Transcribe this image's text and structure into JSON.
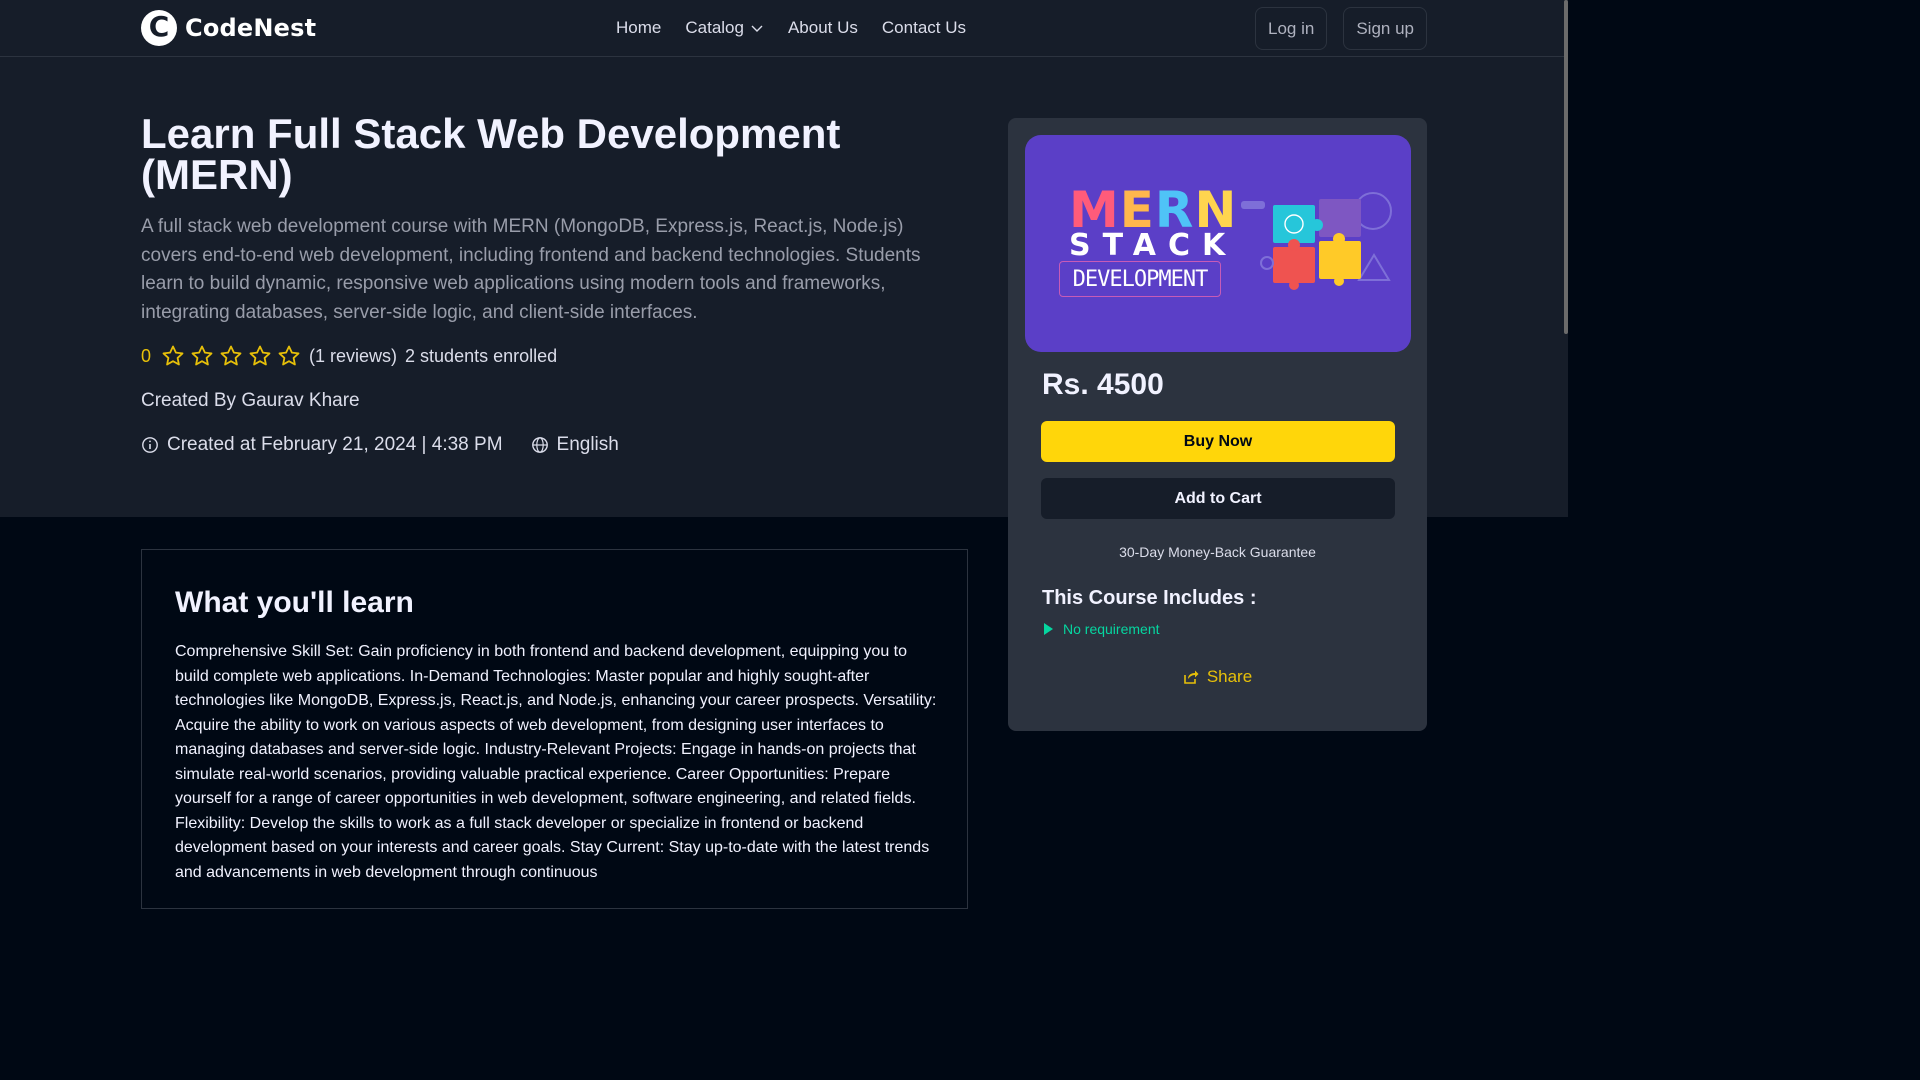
{
  "navbar": {
    "logo_mark": "C",
    "logo_text": "CodeNest",
    "links": [
      "Home",
      "Catalog",
      "About Us",
      "Contact Us"
    ],
    "login": "Log in",
    "signup": "Sign up"
  },
  "course": {
    "title": "Learn Full Stack Web Development (MERN)",
    "description": "A full stack web development course with MERN (MongoDB, Express.js, React.js, Node.js) covers end-to-end web development, including frontend and backend technologies. Students learn to build dynamic, responsive web applications using modern tools and frameworks, integrating databases, server-side logic, and client-side interfaces.",
    "rating": "0",
    "stars_filled": 0,
    "stars_total": 5,
    "reviews": "(1 reviews)",
    "enrolled": "2 students enrolled",
    "creator": "Created By Gaurav Khare",
    "created_at": "Created at February 21, 2024 | 4:38 PM",
    "language": "English"
  },
  "card": {
    "thumbnail": {
      "mern": "MERN",
      "stack": "STACK",
      "development": "DEVELOPMENT",
      "colors": {
        "background": "#5b3fc7",
        "m": "#ff5b7a",
        "e": "#ffb74d",
        "r": "#4fc3f7",
        "n": "#ffd54f"
      }
    },
    "price": "Rs. 4500",
    "buy_now": "Buy Now",
    "add_to_cart": "Add to Cart",
    "guarantee": "30-Day Money-Back Guarantee",
    "includes_title": "This Course Includes :",
    "includes": [
      "No requirement"
    ],
    "share": "Share"
  },
  "learn": {
    "title": "What you'll learn",
    "text": "Comprehensive Skill Set: Gain proficiency in both frontend and backend development, equipping you to build complete web applications. In-Demand Technologies: Master popular and highly sought-after technologies like MongoDB, Express.js, React.js, and Node.js, enhancing your career prospects. Versatility: Acquire the ability to work on various aspects of web development, from designing user interfaces to managing databases and server-side logic. Industry-Relevant Projects: Engage in hands-on projects that simulate real-world scenarios, providing valuable practical experience. Career Opportunities: Prepare yourself for a range of career opportunities in web development, software engineering, and related fields. Flexibility: Develop the skills to work as a full stack developer or specialize in frontend or backend development based on your interests and career goals. Stay Current: Stay up-to-date with the latest trends and advancements in web development through continuous"
  },
  "colors": {
    "accent_yellow": "#ffd60a",
    "rating_yellow": "#e7c009",
    "green": "#06d6a0",
    "bg_dark": "#000814",
    "bg_panel": "#161d29",
    "card": "#2c333f"
  }
}
